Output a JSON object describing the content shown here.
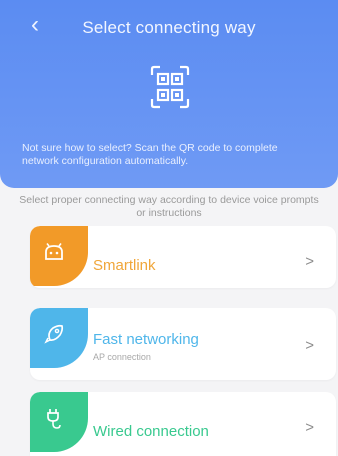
{
  "header": {
    "back_icon": "chevron-left-icon",
    "title": "Select connecting way",
    "qr_icon": "qr-code-icon",
    "hint": "Not sure how to select? Scan the QR code to complete network configuration automatically.",
    "background_color": "#5b8cf2"
  },
  "subtitle": "Select proper connecting way according to device voice prompts or instructions",
  "options": [
    {
      "title": "Smartlink",
      "subtitle": "",
      "icon": "robot-icon",
      "icon_bg": "#f29a28",
      "title_color": "#f0a63a",
      "chevron": ">"
    },
    {
      "title": "Fast networking",
      "subtitle": "AP connection",
      "icon": "rocket-icon",
      "icon_bg": "#4fb6ea",
      "title_color": "#4fb6ea",
      "chevron": ">"
    },
    {
      "title": "Wired connection",
      "subtitle": "",
      "icon": "plug-icon",
      "icon_bg": "#39c98f",
      "title_color": "#39c98f",
      "chevron": ">"
    }
  ]
}
